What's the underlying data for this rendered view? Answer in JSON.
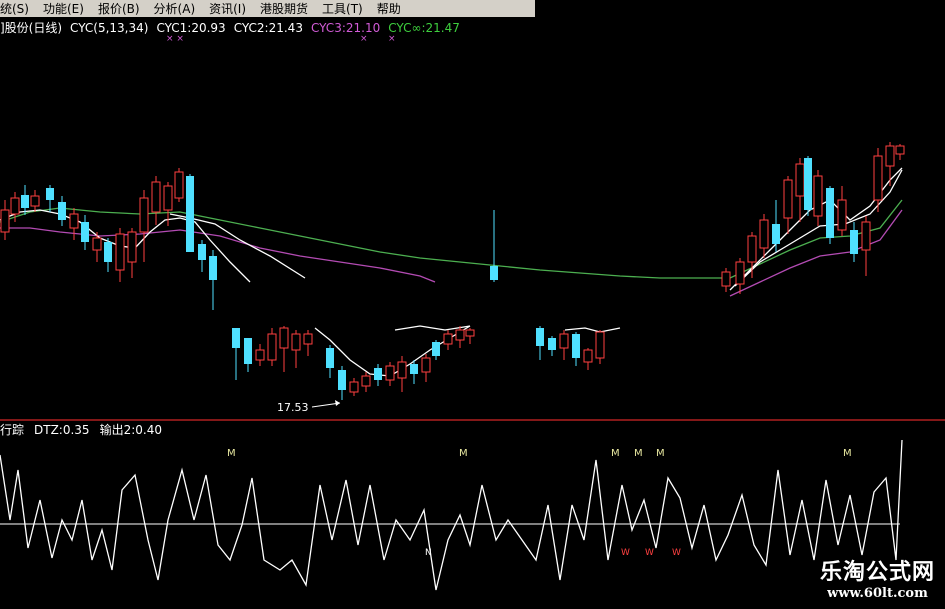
{
  "menu": {
    "items": [
      "统(S)",
      "功能(E)",
      "报价(B)",
      "分析(A)",
      "资讯(I)",
      "港股期货",
      "工具(T)",
      "帮助"
    ]
  },
  "main_legend": {
    "title": "]股份(日线)",
    "indicator": "CYC(5,13,34)",
    "cyc1": "CYC1:20.93",
    "cyc2": "CYC2:21.43",
    "cyc3": "CYC3:21.10",
    "cycinf": "CYC∞:21.47",
    "colors": {
      "cyc1": "#ffffff",
      "cyc2": "#ffffff",
      "cyc3": "#d15bd6",
      "cycinf": "#3ecf3e"
    }
  },
  "low_label": "17.53",
  "sub_legend": {
    "name": "行踪",
    "dtz": "DTZ:0.35",
    "out2": "输出2:0.40"
  },
  "sub_markers": {
    "m_label": "M",
    "w_label": "W",
    "n_label": "N"
  },
  "watermark": {
    "title": "乐淘公式网",
    "url": "www.60lt.com"
  },
  "colors": {
    "up": "#ff4040",
    "down": "#4fe0ff",
    "ma_white": "#ffffff",
    "ma_purple": "#b34bb3",
    "ma_green": "#4caf50",
    "divider": "#b02020"
  }
}
